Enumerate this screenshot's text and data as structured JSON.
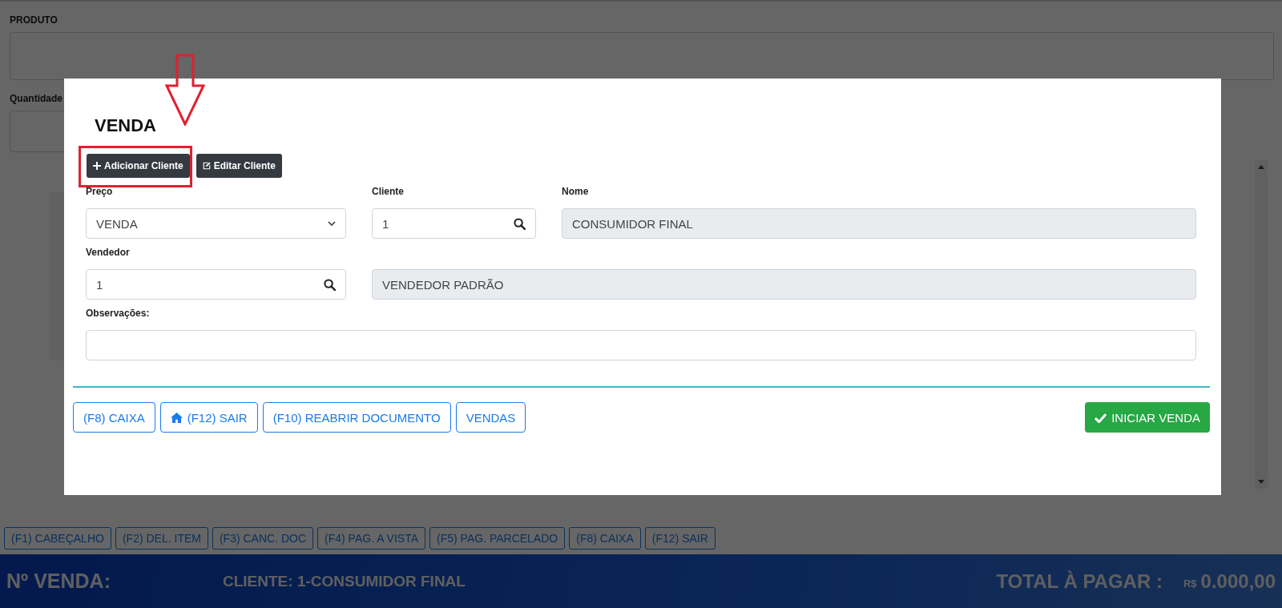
{
  "page": {
    "fields": [
      {
        "label": "PRODUTO"
      },
      {
        "label": "Quantidade"
      }
    ]
  },
  "function_keys": [
    {
      "label": "(F1) CABEÇALHO"
    },
    {
      "label": "(F2) DEL. ITEM"
    },
    {
      "label": "(F3) CANC. DOC"
    },
    {
      "label": "(F4) PAG. A VISTA"
    },
    {
      "label": "(F5) PAG. PARCELADO"
    },
    {
      "label": "(F8) CAIXA"
    },
    {
      "label": "(F12) SAIR"
    }
  ],
  "footer": {
    "sale_number_label": "Nº VENDA:",
    "client": "CLIENTE: 1-CONSUMIDOR FINAL",
    "total_label": "TOTAL À PAGAR :",
    "currency": "R$",
    "total": "0.000,00"
  },
  "modal": {
    "title": "VENDA",
    "header_buttons": [
      {
        "label": "Adicionar Cliente",
        "highlighted": true
      },
      {
        "label": "Editar Cliente",
        "highlighted": false
      }
    ],
    "rows": [
      [
        {
          "label": "Preço",
          "kind": "select",
          "value": "VENDA",
          "disabled": false
        },
        {
          "label": "Cliente",
          "kind": "lookup",
          "value": "1",
          "disabled": false
        },
        {
          "label": "Nome",
          "kind": "text",
          "value": "CONSUMIDOR FINAL",
          "disabled": true
        }
      ],
      [
        {
          "label": "Vendedor",
          "kind": "lookup",
          "value": "1",
          "disabled": false
        },
        {
          "kind": "text",
          "value": "VENDEDOR PADRÃO",
          "disabled": true
        }
      ],
      [
        {
          "label": "Observações:",
          "kind": "text",
          "disabled": false
        }
      ]
    ],
    "footer_buttons": [
      {
        "label": "(F8) CAIXA"
      },
      {
        "label": "(F12) SAIR"
      },
      {
        "label": "(F10) REABRIR DOCUMENTO"
      },
      {
        "label": "VENDAS"
      }
    ],
    "primary_button": {
      "label": "INICIAR VENDA"
    }
  }
}
